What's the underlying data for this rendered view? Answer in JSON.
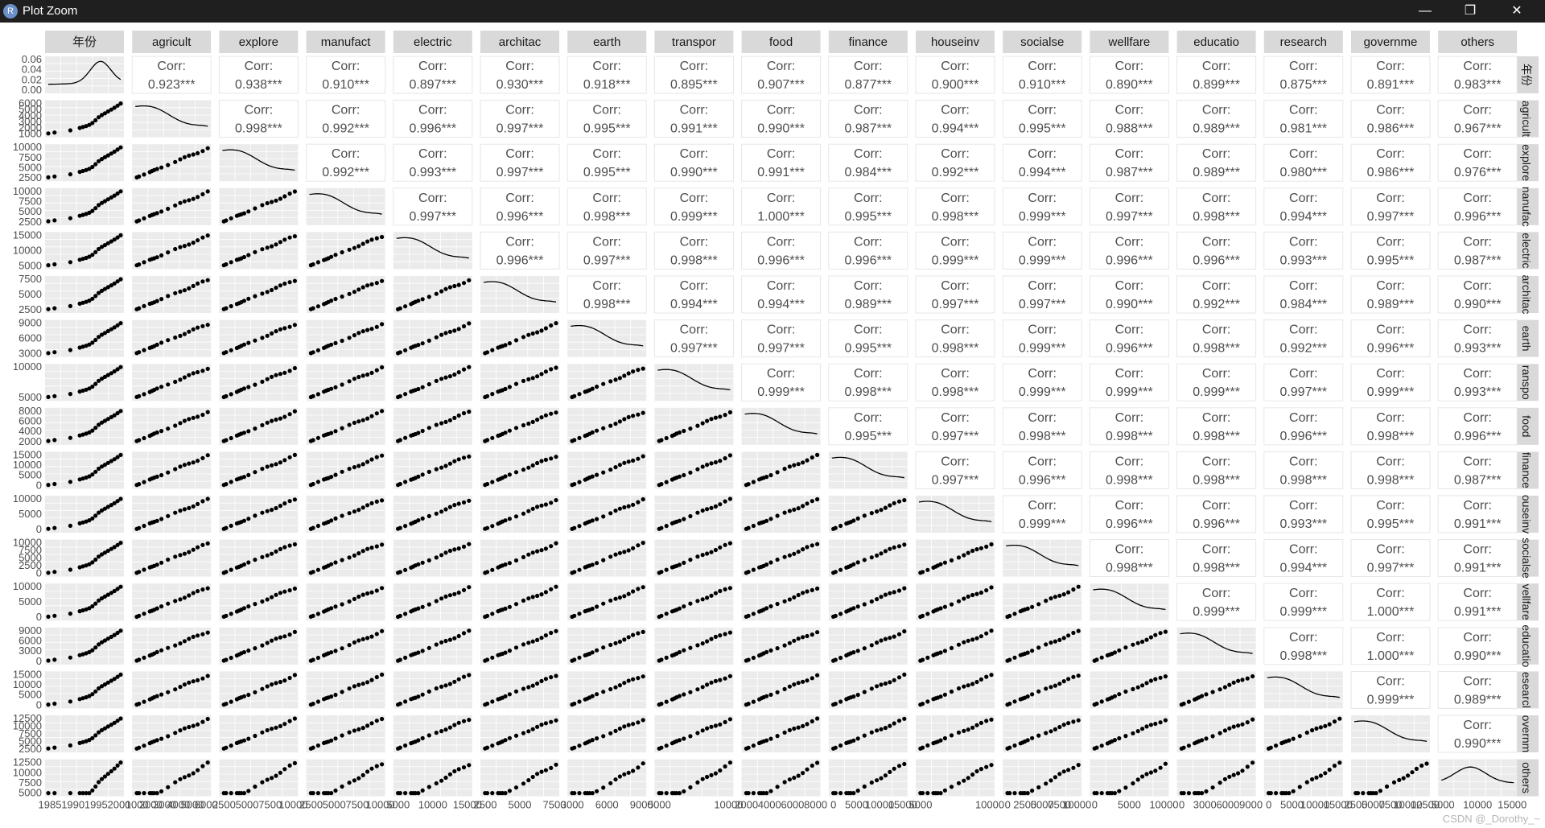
{
  "window": {
    "title": "Plot Zoom",
    "app_icon_letter": "R",
    "minimize_label": "—",
    "maximize_label": "❐",
    "close_label": "✕"
  },
  "watermark": "CSDN @_Dorothy_~",
  "colors": {
    "titlebar": "#1f1f1f",
    "strip": "#d9d9d9",
    "panel": "#ebebeb",
    "grid": "#ffffff",
    "point": "#000000",
    "text": "#4d4d4d"
  },
  "chart_data": {
    "type": "scatter",
    "layout": "ggpairs matrix",
    "variables": [
      "年份",
      "agricult",
      "explore",
      "manufact",
      "electric",
      "architac",
      "earth",
      "transpor",
      "food",
      "finance",
      "houseinv",
      "socialse",
      "wellfare",
      "educatio",
      "research",
      "governme",
      "others"
    ],
    "row_strip_labels": [
      "年份",
      "agricult",
      "explore",
      "nanufac",
      "electric",
      "architac",
      "earth",
      "ranspo",
      "food",
      "finance",
      "ouseinv",
      "socialse",
      "vellfare",
      "educatio",
      "esearcl",
      "overnm",
      "others"
    ],
    "corr_label": "Corr:",
    "correlations": [
      [
        "0.923***",
        "0.938***",
        "0.910***",
        "0.897***",
        "0.930***",
        "0.918***",
        "0.895***",
        "0.907***",
        "0.877***",
        "0.900***",
        "0.910***",
        "0.890***",
        "0.899***",
        "0.875***",
        "0.891***",
        "0.983***"
      ],
      [
        "0.998***",
        "0.992***",
        "0.996***",
        "0.997***",
        "0.995***",
        "0.991***",
        "0.990***",
        "0.987***",
        "0.994***",
        "0.995***",
        "0.988***",
        "0.989***",
        "0.981***",
        "0.986***",
        "0.967***"
      ],
      [
        "0.992***",
        "0.993***",
        "0.997***",
        "0.995***",
        "0.990***",
        "0.991***",
        "0.984***",
        "0.992***",
        "0.994***",
        "0.987***",
        "0.989***",
        "0.980***",
        "0.986***",
        "0.976***"
      ],
      [
        "0.997***",
        "0.996***",
        "0.998***",
        "0.999***",
        "1.000***",
        "0.995***",
        "0.998***",
        "0.999***",
        "0.997***",
        "0.998***",
        "0.994***",
        "0.997***",
        "0.996***"
      ],
      [
        "0.996***",
        "0.997***",
        "0.998***",
        "0.996***",
        "0.996***",
        "0.999***",
        "0.999***",
        "0.996***",
        "0.996***",
        "0.993***",
        "0.995***",
        "0.987***"
      ],
      [
        "0.998***",
        "0.994***",
        "0.994***",
        "0.989***",
        "0.997***",
        "0.997***",
        "0.990***",
        "0.992***",
        "0.984***",
        "0.989***",
        "0.990***"
      ],
      [
        "0.997***",
        "0.997***",
        "0.995***",
        "0.998***",
        "0.999***",
        "0.996***",
        "0.998***",
        "0.992***",
        "0.996***",
        "0.993***"
      ],
      [
        "0.999***",
        "0.998***",
        "0.998***",
        "0.999***",
        "0.999***",
        "0.999***",
        "0.997***",
        "0.999***",
        "0.993***"
      ],
      [
        "0.995***",
        "0.997***",
        "0.998***",
        "0.998***",
        "0.998***",
        "0.996***",
        "0.998***",
        "0.996***"
      ],
      [
        "0.997***",
        "0.996***",
        "0.998***",
        "0.998***",
        "0.998***",
        "0.998***",
        "0.987***"
      ],
      [
        "0.999***",
        "0.996***",
        "0.996***",
        "0.993***",
        "0.995***",
        "0.991***"
      ],
      [
        "0.998***",
        "0.998***",
        "0.994***",
        "0.997***",
        "0.991***"
      ],
      [
        "0.999***",
        "0.999***",
        "1.000***",
        "0.991***"
      ],
      [
        "0.998***",
        "1.000***",
        "0.990***"
      ],
      [
        "0.999***",
        "0.989***"
      ],
      [
        "0.990***"
      ]
    ],
    "y_tick_labels": [
      [
        "0.06",
        "0.04",
        "0.02",
        "0.00"
      ],
      [
        "6000",
        "5000",
        "4000",
        "3000",
        "2000",
        "1000"
      ],
      [
        "10000",
        "7500",
        "5000",
        "2500"
      ],
      [
        "10000",
        "7500",
        "5000",
        "2500"
      ],
      [
        "15000",
        "10000",
        "5000"
      ],
      [
        "7500",
        "5000",
        "2500"
      ],
      [
        "9000",
        "6000",
        "3000"
      ],
      [
        "10000",
        "5000"
      ],
      [
        "8000",
        "6000",
        "4000",
        "2000"
      ],
      [
        "15000",
        "10000",
        "5000",
        "0"
      ],
      [
        "10000",
        "5000",
        "0"
      ],
      [
        "10000",
        "7500",
        "5000",
        "2500",
        "0"
      ],
      [
        "10000",
        "5000",
        "0"
      ],
      [
        "9000",
        "6000",
        "3000",
        "0"
      ],
      [
        "15000",
        "10000",
        "5000",
        "0"
      ],
      [
        "12500",
        "10000",
        "7500",
        "5000",
        "2500"
      ],
      [
        "12500",
        "10000",
        "7500",
        "5000"
      ]
    ],
    "x_tick_labels": [
      [
        "1985",
        "1990",
        "1995",
        "2000"
      ],
      [
        "1000",
        "2000",
        "3000",
        "4000",
        "5000",
        "6000"
      ],
      [
        "2500",
        "5000",
        "7500",
        "10000"
      ],
      [
        "2500",
        "5000",
        "7500",
        "10000"
      ],
      [
        "5000",
        "10000",
        "15000"
      ],
      [
        "2500",
        "5000",
        "7500"
      ],
      [
        "3000",
        "6000",
        "9000"
      ],
      [
        "5000",
        "10000"
      ],
      [
        "2000",
        "4000",
        "6000",
        "8000"
      ],
      [
        "0",
        "5000",
        "10000",
        "15000"
      ],
      [
        "5000",
        "10000"
      ],
      [
        "0",
        "2500",
        "5000",
        "7500",
        "10000"
      ],
      [
        "0",
        "5000",
        "10000"
      ],
      [
        "0",
        "3000",
        "6000",
        "9000"
      ],
      [
        "0",
        "5000",
        "10000",
        "15000"
      ],
      [
        "2500",
        "5000",
        "7500",
        "10000",
        "12500"
      ],
      [
        "5000",
        "10000",
        "15000"
      ]
    ],
    "years": [
      1978,
      1980,
      1985,
      1988,
      1989,
      1990,
      1991,
      1992,
      1993,
      1994,
      1995,
      1996,
      1997,
      1998,
      1999,
      2000,
      2001
    ],
    "trend_shape": [
      0.02,
      0.05,
      0.12,
      0.2,
      0.23,
      0.26,
      0.3,
      0.36,
      0.45,
      0.55,
      0.62,
      0.68,
      0.74,
      0.8,
      0.86,
      0.93,
      1.0
    ]
  }
}
